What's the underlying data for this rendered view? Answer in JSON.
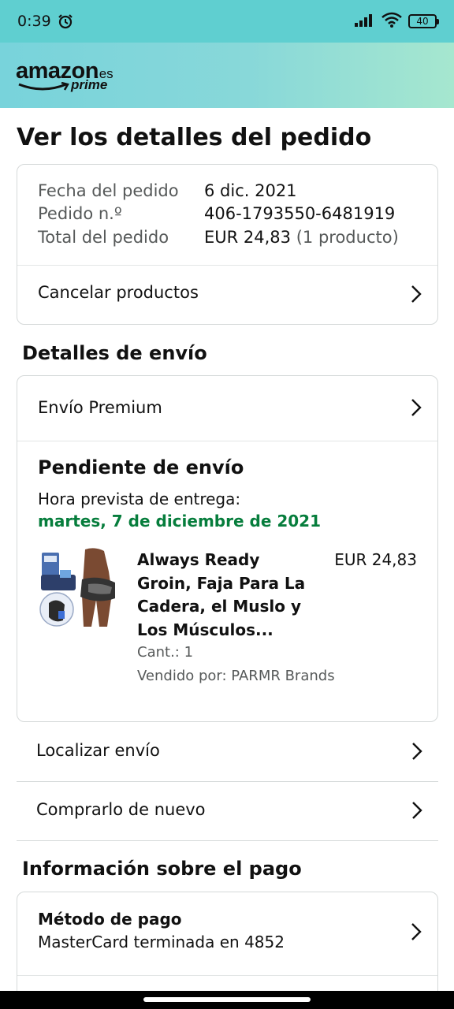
{
  "status_bar": {
    "time": "0:39",
    "battery": "40",
    "icons": [
      "alarm-icon",
      "signal-icon",
      "wifi-icon",
      "battery-icon"
    ]
  },
  "header": {
    "brand": "amazon",
    "region": ".es",
    "tier": "prime",
    "bg_color": "#88d8d9"
  },
  "page": {
    "title": "Ver los detalles del pedido"
  },
  "order_summary": {
    "date_label": "Fecha del pedido",
    "date_value": "6 dic. 2021",
    "number_label": "Pedido n.º",
    "number_value": "406-1793550-6481919",
    "total_label": "Total del pedido",
    "total_value": "EUR 24,83",
    "total_count": "(1 producto)",
    "cancel_label": "Cancelar productos"
  },
  "shipping": {
    "section_title": "Detalles de envío",
    "method": "Envío Premium",
    "status": "Pendiente de envío",
    "eta_label": "Hora prevista de entrega:",
    "eta_date": "martes, 7 de diciembre de 2021",
    "eta_color": "#067d3c",
    "product": {
      "name": "Always Ready Groin, Faja Para La Cadera, el Muslo y Los Músculos...",
      "price": "EUR 24,83",
      "quantity": "Cant.: 1",
      "seller": "Vendido por: PARMR Brands"
    },
    "track_label": "Localizar envío",
    "buy_again_label": "Comprarlo de nuevo"
  },
  "payment": {
    "section_title": "Información sobre el pago",
    "method_title": "Método de pago",
    "method_value": "MasterCard terminada en 4852"
  }
}
